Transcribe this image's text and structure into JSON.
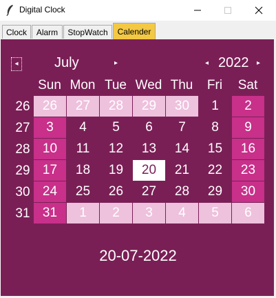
{
  "window": {
    "title": "Digital Clock"
  },
  "tabs": [
    {
      "label": "Clock"
    },
    {
      "label": "Alarm"
    },
    {
      "label": "StopWatch"
    },
    {
      "label": "Calender"
    }
  ],
  "calendar": {
    "month": "July",
    "year": "2022",
    "weekdays": [
      "Sun",
      "Mon",
      "Tue",
      "Wed",
      "Thu",
      "Fri",
      "Sat"
    ],
    "weeks": [
      "26",
      "27",
      "28",
      "29",
      "30",
      "31"
    ],
    "rows": [
      [
        "26",
        "27",
        "28",
        "29",
        "30",
        "1",
        "2"
      ],
      [
        "3",
        "4",
        "5",
        "6",
        "7",
        "8",
        "9"
      ],
      [
        "10",
        "11",
        "12",
        "13",
        "14",
        "15",
        "16"
      ],
      [
        "17",
        "18",
        "19",
        "20",
        "21",
        "22",
        "23"
      ],
      [
        "24",
        "25",
        "26",
        "27",
        "28",
        "29",
        "30"
      ],
      [
        "31",
        "1",
        "2",
        "3",
        "4",
        "5",
        "6"
      ]
    ],
    "selected_date": "20-07-2022"
  },
  "colors": {
    "background": "#7a1f56",
    "weekend": "#c8308a",
    "other_month": "#eec1dd",
    "active_tab": "#f3c844"
  }
}
